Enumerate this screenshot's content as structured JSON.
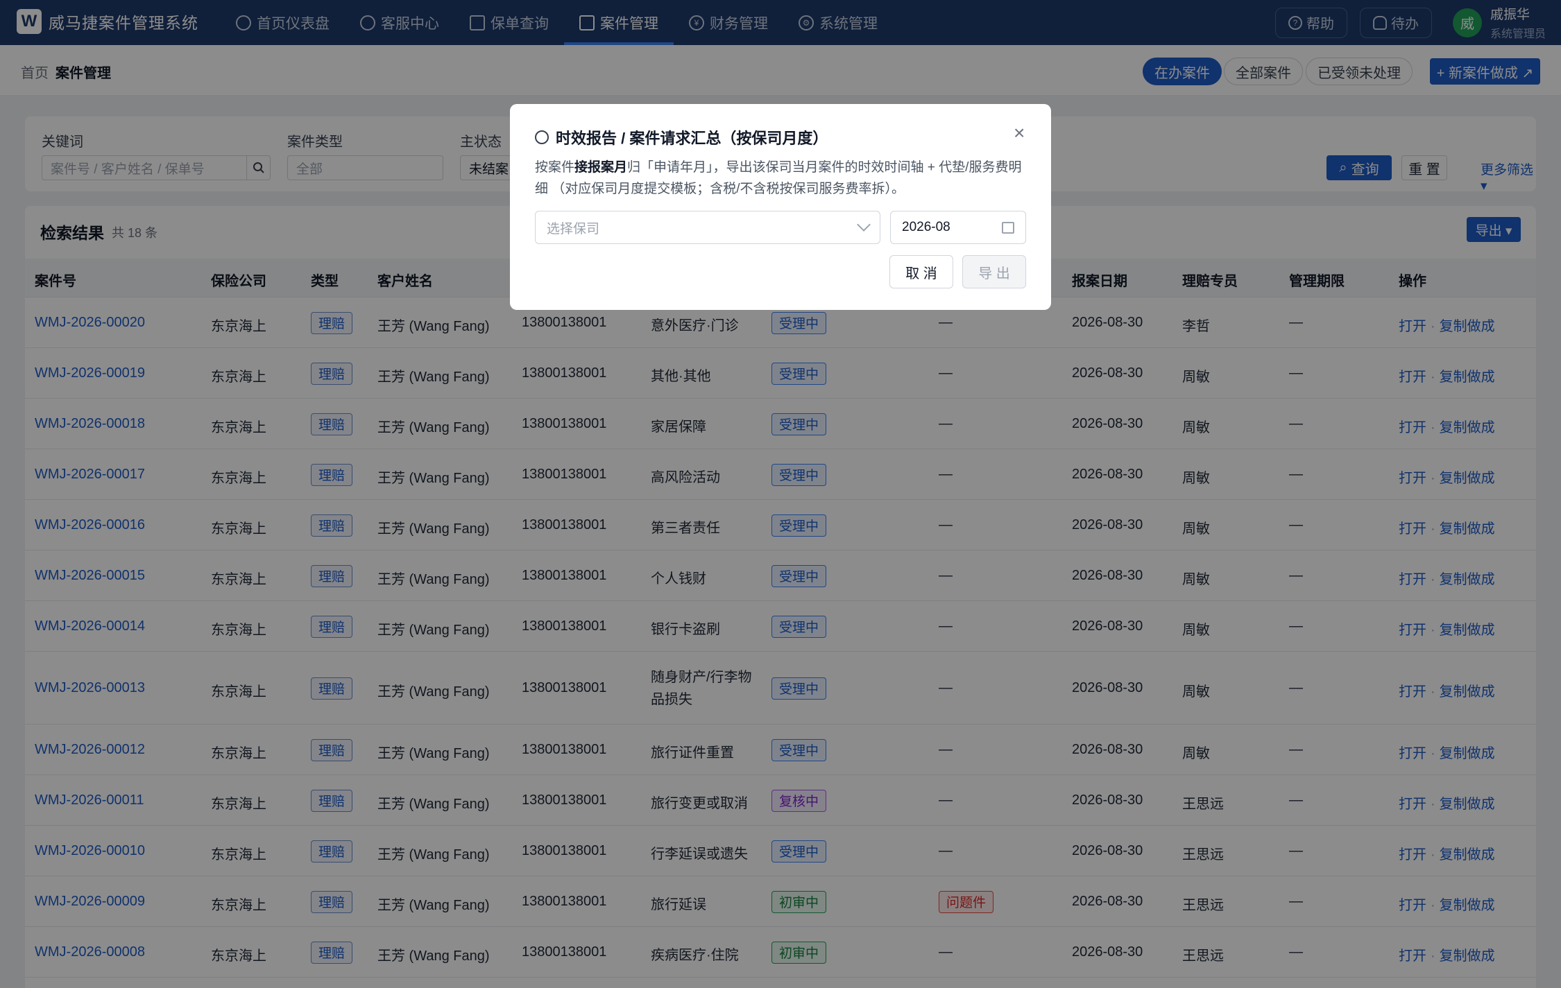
{
  "app": {
    "logo_letter": "W",
    "title": "威马捷案件管理系统"
  },
  "nav": [
    {
      "label": "首页仪表盘",
      "icon": "dashboard-icon"
    },
    {
      "label": "客服中心",
      "icon": "chat-icon"
    },
    {
      "label": "保单查询",
      "icon": "document-icon"
    },
    {
      "label": "案件管理",
      "icon": "folder-icon",
      "active": true
    },
    {
      "label": "财务管理",
      "icon": "yen-icon"
    },
    {
      "label": "系统管理",
      "icon": "gear-icon"
    }
  ],
  "header": {
    "help": "帮助",
    "todo": "待办",
    "avatar": "威",
    "user_name": "戚振华",
    "user_role": "系统管理员"
  },
  "breadcrumb": {
    "home": "首页",
    "current": "案件管理"
  },
  "view_tabs": [
    "在办案件",
    "全部案件",
    "已受领未处理"
  ],
  "new_case_button": "+ 新案件做成 ↗",
  "filter": {
    "keyword_label": "关键词",
    "keyword_placeholder": "案件号 / 客户姓名 / 保单号",
    "type_label": "案件类型",
    "type_value": "全部",
    "status_label": "主状态",
    "status_value": "未结案",
    "query": "查询",
    "reset": "重 置",
    "more": "更多筛选 ▾"
  },
  "results": {
    "title": "检索结果",
    "count": "共 18 条",
    "export": "导出 ▾",
    "columns": [
      "案件号",
      "保险公司",
      "类型",
      "客户姓名",
      "报案日期",
      "理赔专员",
      "管理期限",
      "操作"
    ],
    "op_open": "打开",
    "op_copy": "复制做成",
    "rows": [
      {
        "id": "WMJ-2026-00020",
        "insurer": "东京海上",
        "type": "理赔",
        "customer": "王芳 (Wang Fang)",
        "phone": "13800138001",
        "category": "意外医疗·门诊",
        "status": "受理中",
        "flag": "—",
        "date": "2026-08-30",
        "agent": "李哲",
        "deadline": "—"
      },
      {
        "id": "WMJ-2026-00019",
        "insurer": "东京海上",
        "type": "理赔",
        "customer": "王芳 (Wang Fang)",
        "phone": "13800138001",
        "category": "其他·其他",
        "status": "受理中",
        "flag": "—",
        "date": "2026-08-30",
        "agent": "周敏",
        "deadline": "—"
      },
      {
        "id": "WMJ-2026-00018",
        "insurer": "东京海上",
        "type": "理赔",
        "customer": "王芳 (Wang Fang)",
        "phone": "13800138001",
        "category": "家居保障",
        "status": "受理中",
        "flag": "—",
        "date": "2026-08-30",
        "agent": "周敏",
        "deadline": "—"
      },
      {
        "id": "WMJ-2026-00017",
        "insurer": "东京海上",
        "type": "理赔",
        "customer": "王芳 (Wang Fang)",
        "phone": "13800138001",
        "category": "高风险活动",
        "status": "受理中",
        "flag": "—",
        "date": "2026-08-30",
        "agent": "周敏",
        "deadline": "—"
      },
      {
        "id": "WMJ-2026-00016",
        "insurer": "东京海上",
        "type": "理赔",
        "customer": "王芳 (Wang Fang)",
        "phone": "13800138001",
        "category": "第三者责任",
        "status": "受理中",
        "flag": "—",
        "date": "2026-08-30",
        "agent": "周敏",
        "deadline": "—"
      },
      {
        "id": "WMJ-2026-00015",
        "insurer": "东京海上",
        "type": "理赔",
        "customer": "王芳 (Wang Fang)",
        "phone": "13800138001",
        "category": "个人钱财",
        "status": "受理中",
        "flag": "—",
        "date": "2026-08-30",
        "agent": "周敏",
        "deadline": "—"
      },
      {
        "id": "WMJ-2026-00014",
        "insurer": "东京海上",
        "type": "理赔",
        "customer": "王芳 (Wang Fang)",
        "phone": "13800138001",
        "category": "银行卡盗刷",
        "status": "受理中",
        "flag": "—",
        "date": "2026-08-30",
        "agent": "周敏",
        "deadline": "—"
      },
      {
        "id": "WMJ-2026-00013",
        "insurer": "东京海上",
        "type": "理赔",
        "customer": "王芳 (Wang Fang)",
        "phone": "13800138001",
        "category": "随身财产/行李物品损失",
        "status": "受理中",
        "flag": "—",
        "date": "2026-08-30",
        "agent": "周敏",
        "deadline": "—"
      },
      {
        "id": "WMJ-2026-00012",
        "insurer": "东京海上",
        "type": "理赔",
        "customer": "王芳 (Wang Fang)",
        "phone": "13800138001",
        "category": "旅行证件重置",
        "status": "受理中",
        "flag": "—",
        "date": "2026-08-30",
        "agent": "周敏",
        "deadline": "—"
      },
      {
        "id": "WMJ-2026-00011",
        "insurer": "东京海上",
        "type": "理赔",
        "customer": "王芳 (Wang Fang)",
        "phone": "13800138001",
        "category": "旅行变更或取消",
        "status": "复核中",
        "flag": "—",
        "date": "2026-08-30",
        "agent": "王思远",
        "deadline": "—"
      },
      {
        "id": "WMJ-2026-00010",
        "insurer": "东京海上",
        "type": "理赔",
        "customer": "王芳 (Wang Fang)",
        "phone": "13800138001",
        "category": "行李延误或遗失",
        "status": "受理中",
        "flag": "—",
        "date": "2026-08-30",
        "agent": "王思远",
        "deadline": "—"
      },
      {
        "id": "WMJ-2026-00009",
        "insurer": "东京海上",
        "type": "理赔",
        "customer": "王芳 (Wang Fang)",
        "phone": "13800138001",
        "category": "旅行延误",
        "status": "初审中",
        "flag": "问题件",
        "date": "2026-08-30",
        "agent": "王思远",
        "deadline": "—"
      },
      {
        "id": "WMJ-2026-00008",
        "insurer": "东京海上",
        "type": "理赔",
        "customer": "王芳 (Wang Fang)",
        "phone": "13800138001",
        "category": "疾病医疗·住院",
        "status": "初审中",
        "flag": "—",
        "date": "2026-08-30",
        "agent": "王思远",
        "deadline": "—"
      }
    ]
  },
  "modal": {
    "title": "时效报告 / 案件请求汇总（按保司月度）",
    "desc_prefix": "按案件",
    "desc_bold": "接报案月",
    "desc_rest": "归「申请年月」，导出该保司当月案件的时效时间轴 + 代垫/服务费明细 （对应保司月度提交模板；含税/不含税按保司服务费率拆）。",
    "insurer_placeholder": "选择保司",
    "month_value": "2026-08",
    "cancel": "取 消",
    "export": "导 出"
  },
  "colors": {
    "nav_bg": "#1e3a6b",
    "primary": "#1e5bc6",
    "overlay": "rgba(0,0,0,0.45)"
  }
}
